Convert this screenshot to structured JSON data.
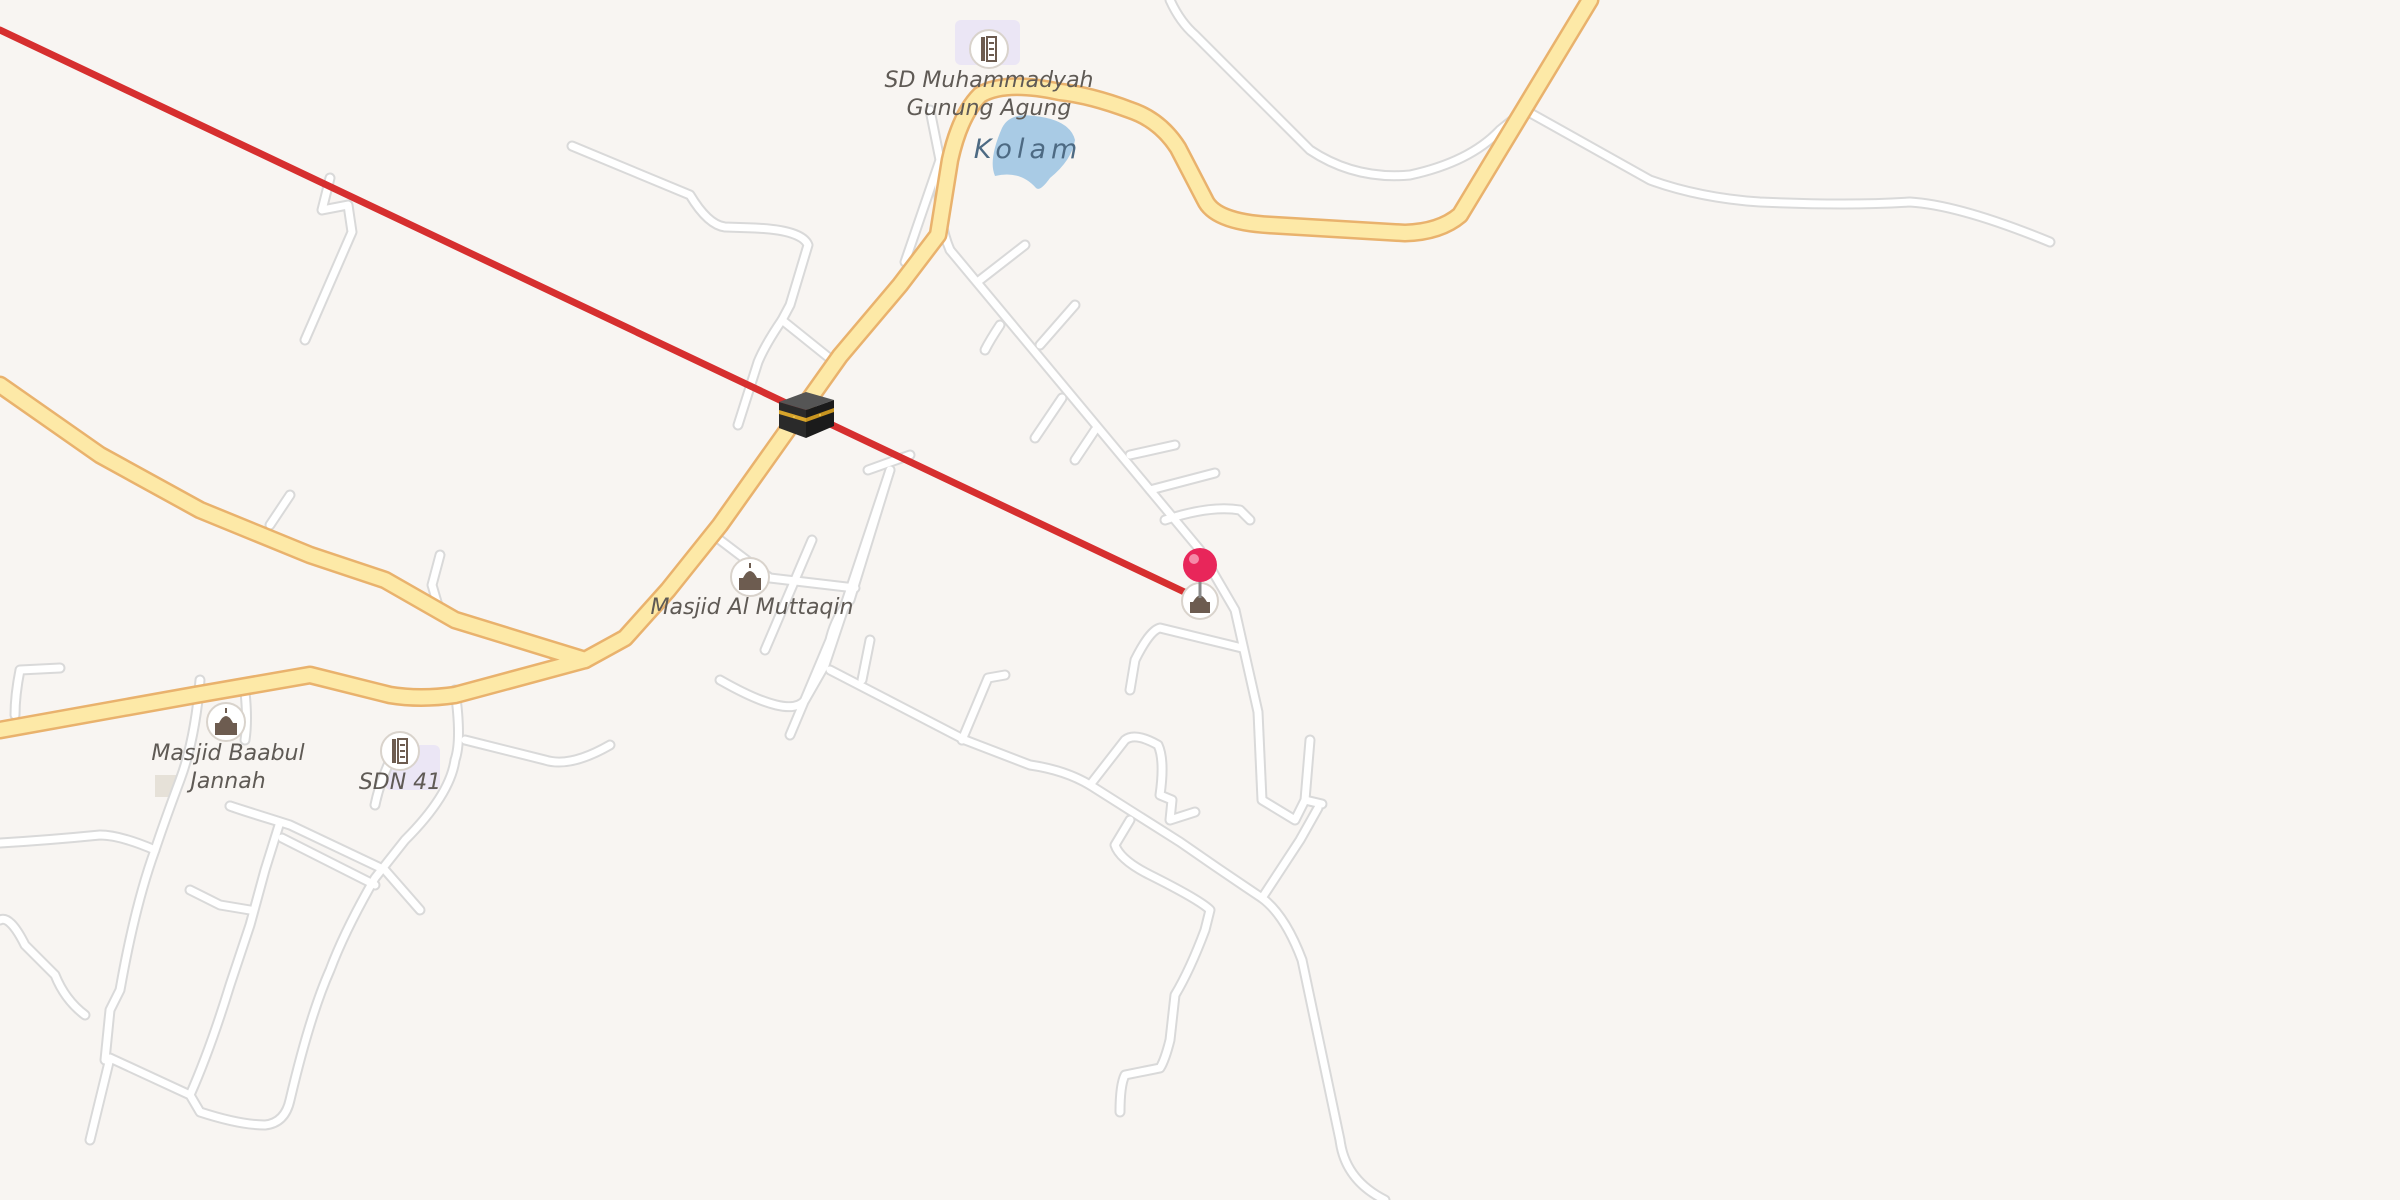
{
  "map": {
    "background": "#f8f5f2",
    "colors": {
      "minor_road": "#ffffff",
      "minor_road_casing": "#dcdcdc",
      "major_road": "#fde9a7",
      "major_road_casing": "#eab66f",
      "water": "#a9cbe5",
      "qibla_line": "#d62f2f",
      "pin": "#e8265a",
      "poi_icon": "#6d5c50"
    },
    "labels": {
      "school_1": [
        "SD Muhammadyah",
        "Gunung Agung"
      ],
      "water": "Kolam",
      "mosque_1": "Masjid Al Muttaqin",
      "mosque_2": [
        "Masjid Baabul",
        "Jannah"
      ],
      "school_2": "SDN 41"
    },
    "markers": {
      "kaaba": "kaaba-icon",
      "location": "map-pin-icon",
      "mosque": "mosque-icon",
      "school": "school-icon"
    }
  }
}
